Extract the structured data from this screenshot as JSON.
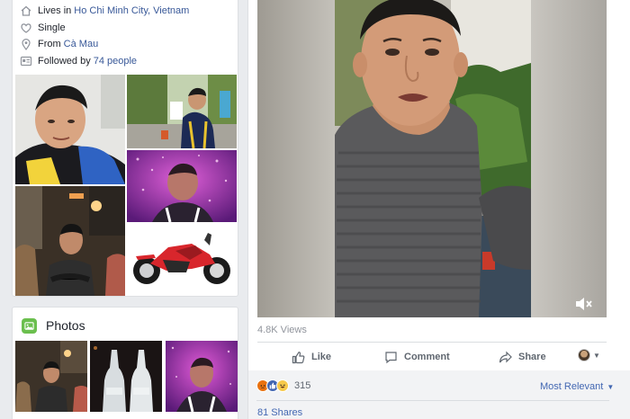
{
  "intro": {
    "lives_prefix": "Lives in",
    "lives_place": "Ho Chi Minh City, Vietnam",
    "relationship": "Single",
    "from_prefix": "From",
    "from_place": "Cà Mau",
    "followed_prefix": "Followed by",
    "followed_count": "74 people"
  },
  "photos_section": {
    "title": "Photos"
  },
  "post": {
    "views": "4.8K Views",
    "actions": {
      "like": "Like",
      "comment": "Comment",
      "share": "Share"
    },
    "reactions_count": "315",
    "sort_label": "Most Relevant",
    "shares": "81 Shares"
  },
  "colors": {
    "link": "#385898",
    "brand": "#4267b2",
    "page_bg": "#e9ebee"
  }
}
